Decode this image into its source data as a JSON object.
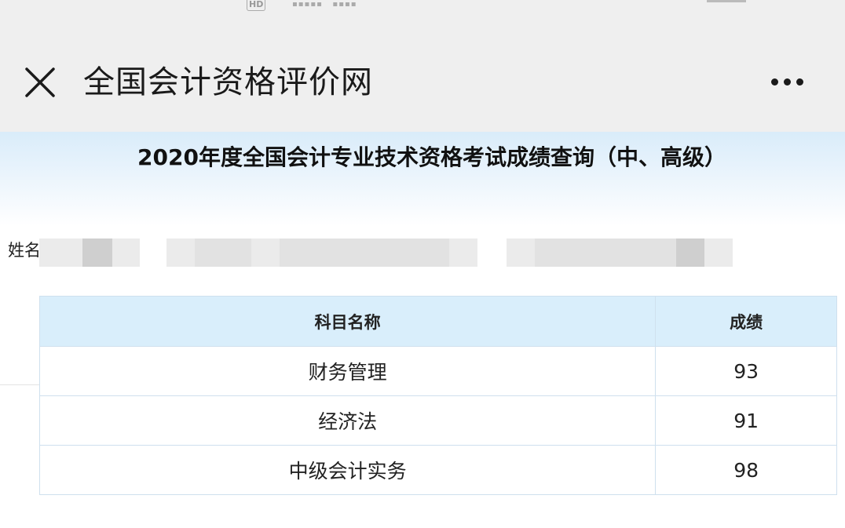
{
  "status_bar": {
    "network_label": "HD"
  },
  "header": {
    "close_icon": "close-icon",
    "title": "全国会计资格评价网",
    "more_icon": "more-dots-icon"
  },
  "page": {
    "title": "2020年度全国会计专业技术资格考试成绩查询（中、高级）"
  },
  "info": {
    "name_label": "姓名"
  },
  "score_table": {
    "columns": [
      "科目名称",
      "成绩"
    ],
    "rows": [
      {
        "subject": "财务管理",
        "score": "93"
      },
      {
        "subject": "经济法",
        "score": "91"
      },
      {
        "subject": "中级会计实务",
        "score": "98"
      }
    ]
  },
  "colors": {
    "header_bg": "#efefef",
    "table_header_bg": "#d9eefb",
    "table_border": "#cfe0ee",
    "title_band_top": "#d9ecfa"
  }
}
